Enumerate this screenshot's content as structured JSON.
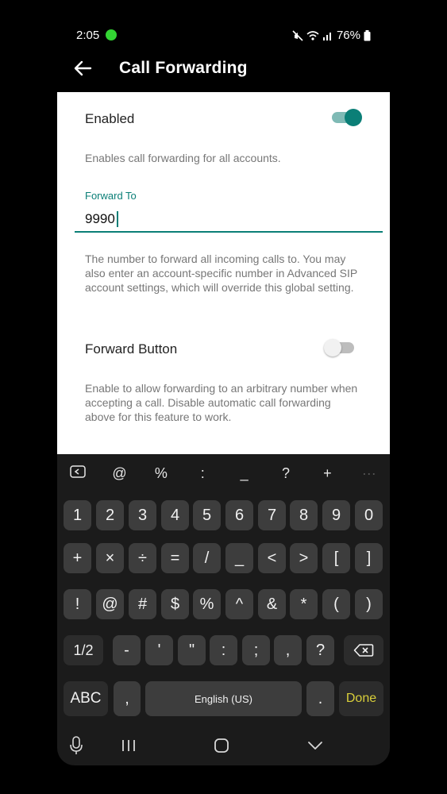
{
  "status": {
    "time": "2:05",
    "battery": "76%"
  },
  "appbar": {
    "title": "Call Forwarding"
  },
  "settings": {
    "enabled": {
      "label": "Enabled",
      "on": true,
      "desc": "Enables call forwarding for all accounts."
    },
    "forward_to": {
      "label": "Forward To",
      "value": "9990",
      "desc": "The number to forward all incoming calls to. You may also enter an account-specific number in Advanced SIP account settings, which will override this global setting."
    },
    "forward_button": {
      "label": "Forward Button",
      "on": false,
      "desc": "Enable to allow forwarding to an arbitrary number when accepting a call. Disable automatic call forwarding above for this feature to work."
    }
  },
  "keyboard": {
    "symbols": [
      "@",
      "%",
      ":",
      "_",
      "?",
      "+",
      "···"
    ],
    "rows": [
      [
        "1",
        "2",
        "3",
        "4",
        "5",
        "6",
        "7",
        "8",
        "9",
        "0"
      ],
      [
        "+",
        "×",
        "÷",
        "=",
        "/",
        "_",
        "<",
        ">",
        "[",
        "]"
      ],
      [
        "!",
        "@",
        "#",
        "$",
        "%",
        "^",
        "&",
        "*",
        "(",
        ")"
      ],
      [
        "1/2",
        "-",
        "'",
        "\"",
        ":",
        ";",
        ",",
        "?"
      ],
      [
        "ABC",
        ",",
        "English (US)",
        ".",
        "Done"
      ]
    ]
  },
  "colors": {
    "accent": "#0b7f77",
    "done": "#d9cf3a"
  }
}
